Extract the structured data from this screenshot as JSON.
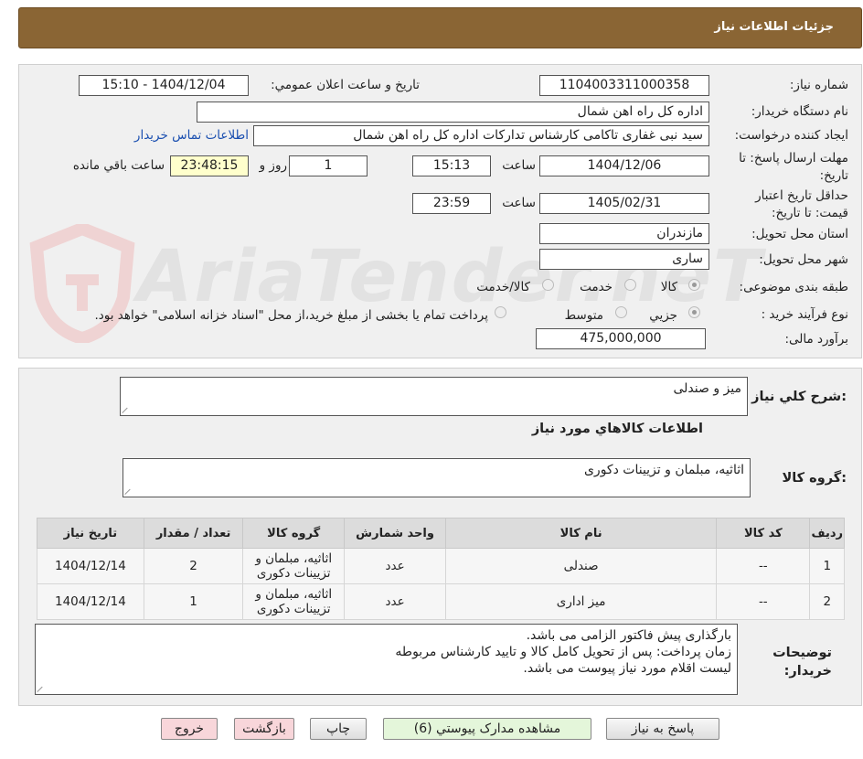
{
  "header": {
    "title": "جزئیات اطلاعات نیاز"
  },
  "watermark": {
    "text": "AriaTender.neT"
  },
  "form": {
    "need_number_label": "شماره نیاز:",
    "need_number": "1104003311000358",
    "announce_label": "تاریخ و ساعت اعلان عمومي:",
    "announce_value": "1404/12/04 - 15:10",
    "buyer_org_label": "نام دستگاه خریدار:",
    "buyer_org": "اداره کل راه اهن شمال",
    "requester_label": "ایجاد کننده درخواست:",
    "requester": "سید نبی غفاری تاکامی کارشناس تدارکات اداره کل راه اهن شمال",
    "contact_link": "اطلاعات تماس خریدار",
    "reply_deadline_label": "مهلت ارسال پاسخ: تا تاریخ:",
    "reply_date": "1404/12/06",
    "time_label": "ساعت",
    "reply_time": "15:13",
    "days_value": "1",
    "days_label": "روز و",
    "remaining_time": "23:48:15",
    "remaining_label": "ساعت باقي مانده",
    "price_validity_label": "حداقل تاريخ اعتبار قیمت: تا تاریخ:",
    "validity_date": "1405/02/31",
    "validity_time": "23:59",
    "province_label": "استان محل تحویل:",
    "province": "مازندران",
    "city_label": "شهر محل تحویل:",
    "city": "ساری",
    "category_label": "طبقه بندی موضوعی:",
    "category_options": [
      "کالا",
      "خدمت",
      "کالا/خدمت"
    ],
    "purchase_type_label": "نوع فرآیند خرید :",
    "purchase_options": [
      "جزیي",
      "متوسط"
    ],
    "purchase_note": "پرداخت تمام یا بخشی از مبلغ خرید،از محل \"اسناد خزانه اسلامی\" خواهد بود.",
    "budget_label": "برآورد مالی:",
    "budget": "475,000,000"
  },
  "summary": {
    "desc_label": "شرح کلي نیاز:",
    "desc": "میز و صندلی",
    "goods_info_title": "اطلاعات کالاهاي مورد نیاز",
    "goods_group_label": "گروه کالا:",
    "goods_group": "اثاثیه، مبلمان و تزیینات دکوری"
  },
  "table": {
    "headers": [
      "ردیف",
      "کد کالا",
      "نام کالا",
      "واحد شمارش",
      "گروه کالا",
      "تعداد / مقدار",
      "تاریخ نیاز"
    ],
    "rows": [
      [
        "1",
        "--",
        "صندلی",
        "عدد",
        "اثاثیه، مبلمان و تزیینات دکوری",
        "2",
        "1404/12/14"
      ],
      [
        "2",
        "--",
        "میز اداری",
        "عدد",
        "اثاثیه، مبلمان و تزیینات دکوری",
        "1",
        "1404/12/14"
      ]
    ]
  },
  "notes": {
    "label": "توضیحات خریدار:",
    "lines": [
      "بارگذاری پیش فاکتور الزامی می باشد.",
      "زمان پرداخت: پس از تحویل کامل کالا و تایید کارشناس مربوطه",
      "لیست اقلام مورد نیاز پیوست می باشد."
    ]
  },
  "buttons": {
    "reply": "پاسخ به نیاز",
    "docs": "مشاهده مدارک پیوستي (6)",
    "print": "چاپ",
    "back": "بازگشت",
    "exit": "خروج"
  }
}
